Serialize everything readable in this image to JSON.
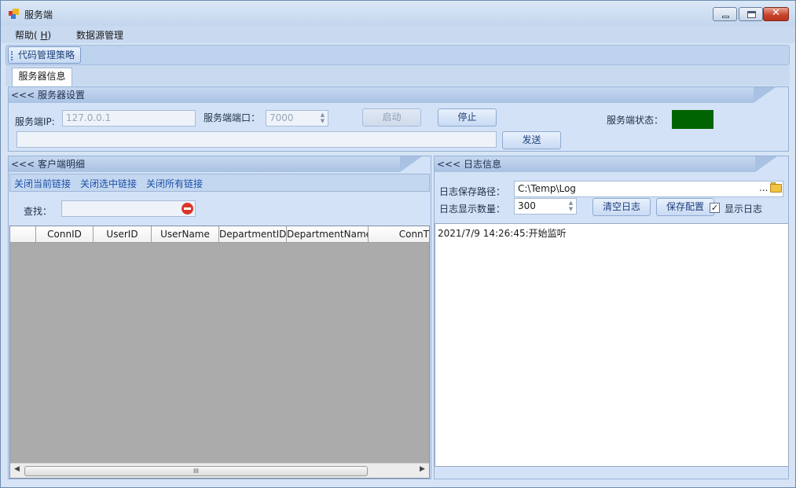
{
  "window": {
    "title": "服务端"
  },
  "menu": {
    "help_label": "帮助(",
    "help_key": "H",
    "help_suffix": ")",
    "datasource_label": "数据源管理"
  },
  "toolbar": {
    "strategy_label": "代码管理策略"
  },
  "tabs": [
    {
      "label": "服务器信息"
    }
  ],
  "server_settings": {
    "header": "<<< 服务器设置",
    "ip_label": "服务端IP:",
    "ip_value": "127.0.0.1",
    "port_label": "服务端端口：",
    "port_value": "7000",
    "start_label": "启动",
    "stop_label": "停止",
    "status_label": "服务端状态：",
    "status_color": "#006400",
    "message_value": "",
    "send_label": "发送"
  },
  "clients": {
    "header": "<<< 客户端明细",
    "actions": [
      "关闭当前链接",
      "关闭选中链接",
      "关闭所有链接"
    ],
    "search_label": "查找：",
    "search_value": "",
    "columns": [
      "",
      "ConnID",
      "UserID",
      "UserName",
      "DepartmentID",
      "DepartmentName",
      "ConnT"
    ],
    "scroll_grip": "III",
    "scroll_left_icon": "arrow-left",
    "scroll_right_icon": "arrow-right"
  },
  "log": {
    "header": "<<< 日志信息",
    "path_label": "日志保存路径：",
    "path_value": "C:\\Temp\\Log",
    "path_ellipsis": "...",
    "count_label": "日志显示数量：",
    "count_value": "300",
    "clear_label": "清空日志",
    "save_label": "保存配置",
    "show_checked": true,
    "show_label": "显示日志",
    "entries": [
      "2021/7/9 14:26:45:开始监听"
    ]
  }
}
